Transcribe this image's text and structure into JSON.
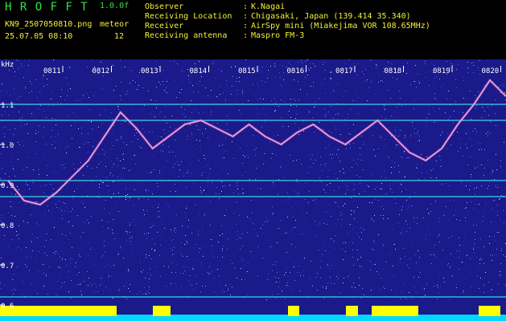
{
  "header": {
    "title": "H R O F F T",
    "version": "1.0.0f",
    "filename": "KN9_2507050810.png",
    "source": "meteor",
    "datetime": "25.07.05 08:10",
    "count": "12",
    "fields": [
      {
        "key": "Observer",
        "value": "K.Nagai"
      },
      {
        "key": "Receiving Location",
        "value": "Chigasaki, Japan (139.414 35.340)"
      },
      {
        "key": "Receiver",
        "value": "AirSpy mini (Miakejima VOR 108.65MHz)"
      },
      {
        "key": "Receiving antenna",
        "value": "Maspro FM-3"
      }
    ]
  },
  "plot": {
    "unit": "kHz",
    "y_ticks": [
      "1.1",
      "1.0",
      "0.9",
      "0.8",
      "0.7",
      "0.6"
    ],
    "time_ticks": [
      "0811",
      "0812",
      "0813",
      "0814",
      "0815",
      "0816",
      "0817",
      "0818",
      "0819",
      "0820"
    ]
  },
  "chart_data": {
    "type": "heatmap",
    "ylabel": "kHz",
    "ylim": [
      0.6,
      1.16
    ],
    "yticks": [
      0.6,
      0.7,
      0.8,
      0.9,
      1.0,
      1.1
    ],
    "x": [
      "0811",
      "0812",
      "0813",
      "0814",
      "0815",
      "0816",
      "0817",
      "0818",
      "0819",
      "0820"
    ],
    "horizontal_lines_khz": [
      1.1,
      1.06,
      0.91,
      0.87,
      0.62
    ],
    "trace_khz": [
      0.91,
      0.86,
      0.85,
      0.88,
      0.92,
      0.96,
      1.02,
      1.08,
      1.04,
      0.99,
      1.02,
      1.05,
      1.06,
      1.04,
      1.02,
      1.05,
      1.02,
      1.0,
      1.03,
      1.05,
      1.02,
      1.0,
      1.03,
      1.06,
      1.02,
      0.98,
      0.96,
      0.99,
      1.05,
      1.1,
      1.16,
      1.12
    ]
  },
  "colors": {
    "background": "#1a1a8a",
    "header_green": "#33e24d",
    "header_yellow": "#f4ef3a",
    "line_cyan": "#3ad8e8",
    "trace": "#d8c0ff",
    "bar_yellow": "#ffff00",
    "bar_cyan": "#00d8ff"
  }
}
